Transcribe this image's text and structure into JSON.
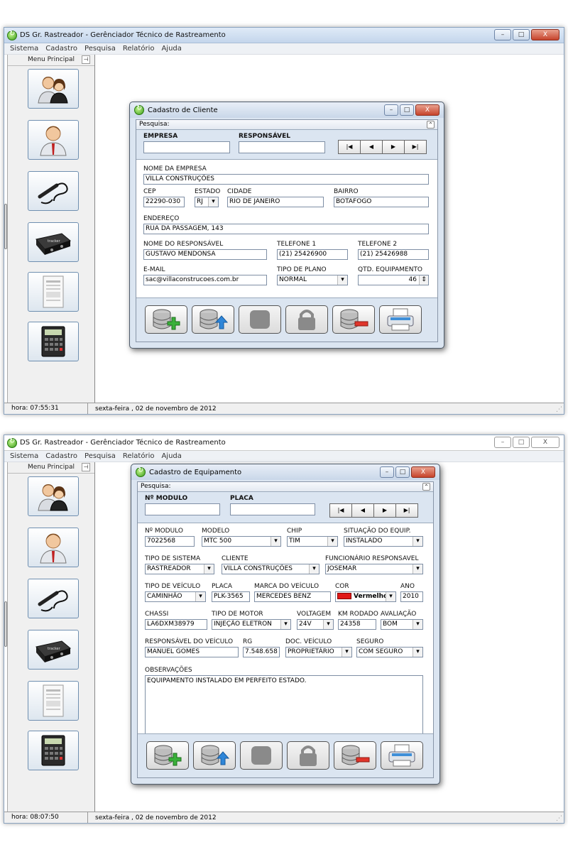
{
  "app": {
    "title": "DS Gr. Rastreador - Gerênciador Técnico de Rastreamento",
    "menu": [
      "Sistema",
      "Cadastro",
      "Pesquisa",
      "Relatório",
      "Ajuda"
    ],
    "sidebar_title": "Menu Principal",
    "sidebar_buttons": [
      "users-icon",
      "person-icon",
      "cable-icon",
      "tracker-device-icon",
      "document-icon",
      "calculator-icon"
    ],
    "window_controls": [
      "–",
      "□",
      "X"
    ]
  },
  "screen1": {
    "status_time": "hora:  07:55:31",
    "status_date": "sexta-feira ,  02 de novembro de 2012",
    "dialog": {
      "title": "Cadastro de Cliente",
      "search_label": "Pesquisa:",
      "search_fields": {
        "empresa_label": "EMPRESA",
        "empresa_value": "",
        "responsavel_label": "RESPONSÁVEL",
        "responsavel_value": ""
      },
      "nav": [
        "|◀",
        "◀",
        "▶",
        "▶|"
      ],
      "nome_empresa": {
        "label": "NOME DA EMPRESA",
        "value": "VILLA CONSTRUÇÕES"
      },
      "cep": {
        "label": "CEP",
        "value": "22290-030"
      },
      "estado": {
        "label": "ESTADO",
        "value": "RJ"
      },
      "cidade": {
        "label": "CIDADE",
        "value": "RIO DE JANEIRO"
      },
      "bairro": {
        "label": "BAIRRO",
        "value": "BOTAFOGO"
      },
      "endereco": {
        "label": "ENDEREÇO",
        "value": "RUA DA PASSAGEM, 143"
      },
      "nome_responsavel": {
        "label": "NOME DO RESPONSÁVEL",
        "value": "GUSTAVO MENDONSA"
      },
      "telefone1": {
        "label": "TELEFONE 1",
        "value": "(21) 25426900"
      },
      "telefone2": {
        "label": "TELEFONE 2",
        "value": "(21) 25426988"
      },
      "email": {
        "label": "E-MAIL",
        "value": "sac@villaconstrucoes.com.br"
      },
      "tipo_plano": {
        "label": "TIPO DE PLANO",
        "value": "NORMAL"
      },
      "qtd_equipamento": {
        "label": "QTD. EQUIPAMENTO",
        "value": "46"
      }
    }
  },
  "screen2": {
    "status_time": "hora:  08:07:50",
    "status_date": "sexta-feira ,  02 de novembro de 2012",
    "dialog": {
      "title": "Cadastro de Equipamento",
      "search_label": "Pesquisa:",
      "search_fields": {
        "modulo_label": "Nº MODULO",
        "modulo_value": "",
        "placa_label": "PLACA",
        "placa_value": ""
      },
      "nav": [
        "|◀",
        "◀",
        "▶",
        "▶|"
      ],
      "n_modulo": {
        "label": "Nº MODULO",
        "value": "7022568"
      },
      "modelo": {
        "label": "MODELO",
        "value": "MTC 500"
      },
      "chip": {
        "label": "CHIP",
        "value": "TIM"
      },
      "situacao": {
        "label": "SITUAÇÃO DO EQUIP.",
        "value": "INSTALADO"
      },
      "tipo_sistema": {
        "label": "TIPO DE SISTEMA",
        "value": "RASTREADOR"
      },
      "cliente": {
        "label": "CLIENTE",
        "value": "VILLA CONSTRUÇÕES"
      },
      "funcionario": {
        "label": "FUNCIONÁRIO RESPONSAVEL",
        "value": "JOSEMAR"
      },
      "tipo_veiculo": {
        "label": "TIPO DE VEÍCULO",
        "value": "CAMINHÃO"
      },
      "placa": {
        "label": "PLACA",
        "value": "PLK-3565"
      },
      "marca": {
        "label": "MARCA DO VEÍCULO",
        "value": "MERCEDES BENZ"
      },
      "cor": {
        "label": "COR",
        "value": "Vermelho",
        "swatch": "#e01818"
      },
      "ano": {
        "label": "ANO",
        "value": "2010"
      },
      "chassi": {
        "label": "CHASSI",
        "value": "LA6DXM38979"
      },
      "tipo_motor": {
        "label": "TIPO DE MOTOR",
        "value": "INJEÇÃO ELETRON"
      },
      "voltagem": {
        "label": "VOLTAGEM",
        "value": "24V"
      },
      "km_rodado": {
        "label": "KM RODADO",
        "value": "24358"
      },
      "avaliacao": {
        "label": "AVALIAÇÃO",
        "value": "BOM"
      },
      "responsavel_veiculo": {
        "label": "RESPONSÁVEL DO VEÍCULO",
        "value": "MANUEL GOMES"
      },
      "rg": {
        "label": "RG",
        "value": "7.548.658"
      },
      "doc_veiculo": {
        "label": "DOC. VEÍCULO",
        "value": "PROPRIETÁRIO"
      },
      "seguro": {
        "label": "SEGURO",
        "value": "COM SEGURO"
      },
      "observacoes": {
        "label": "OBSERVAÇÕES",
        "value": "EQUIPAMENTO INSTALADO EM PERFEITO ESTADO."
      }
    }
  }
}
